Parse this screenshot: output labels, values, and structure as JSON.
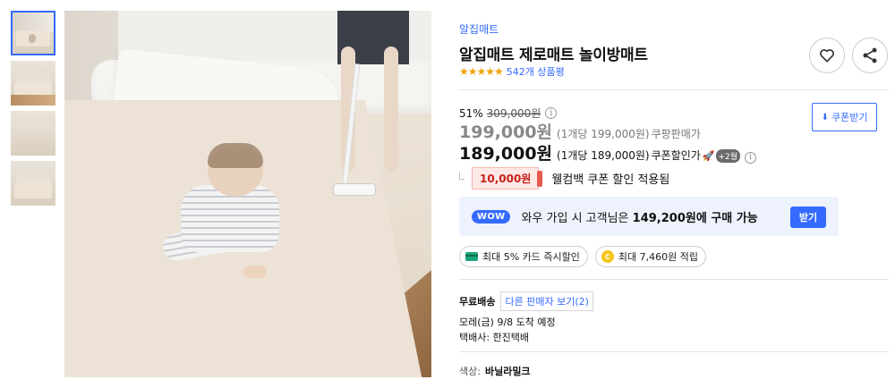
{
  "thumbnails": [
    "thumb-1",
    "thumb-2",
    "thumb-3",
    "thumb-4"
  ],
  "product": {
    "brand": "알집매트",
    "title": "알집매트 제로매트 놀이방매트",
    "stars": "★★★★★",
    "review_count": "542개 상품평",
    "rating_of_5": 5
  },
  "pricing": {
    "discount_pct": "51%",
    "original_price": "309,000원",
    "info_glyph": "i",
    "coupang_price": "199,000원",
    "coupang_unit": "(1개당 199,000원)",
    "coupang_label": "쿠팡판매가",
    "coupon_price": "189,000원",
    "coupon_unit": "(1개당 189,000원)",
    "coupon_label": "쿠폰할인가",
    "rocket_glyph": "🚀",
    "plus_badge": "+2월",
    "coupon_button": "쿠폰받기",
    "coupon_button_icon": "⬇"
  },
  "coupon": {
    "amount": "10,000원",
    "text": "웰컴백 쿠폰 할인 적용됨"
  },
  "wow": {
    "badge": "WOW",
    "text_prefix": "와우 가입 시 고객님은",
    "text_price": "149,200원에 구매 가능",
    "button": "받기"
  },
  "benefits": {
    "card": "최대 5% 카드 즉시할인",
    "points": "최대 7,460원 적립",
    "coin_glyph": "C"
  },
  "shipping": {
    "label": "무료배송",
    "other_sellers": "다른 판매자 보기(2)",
    "arrival": "모레(금) 9/8 도착 예정",
    "courier": "택배사: 한진택배"
  },
  "option": {
    "label": "색상:",
    "value": "바닐라밀크"
  },
  "colors": {
    "accent": "#346aff",
    "star": "#f0a30a",
    "coupon_red": "#c9201a",
    "wow_bg": "#edf2fc"
  }
}
